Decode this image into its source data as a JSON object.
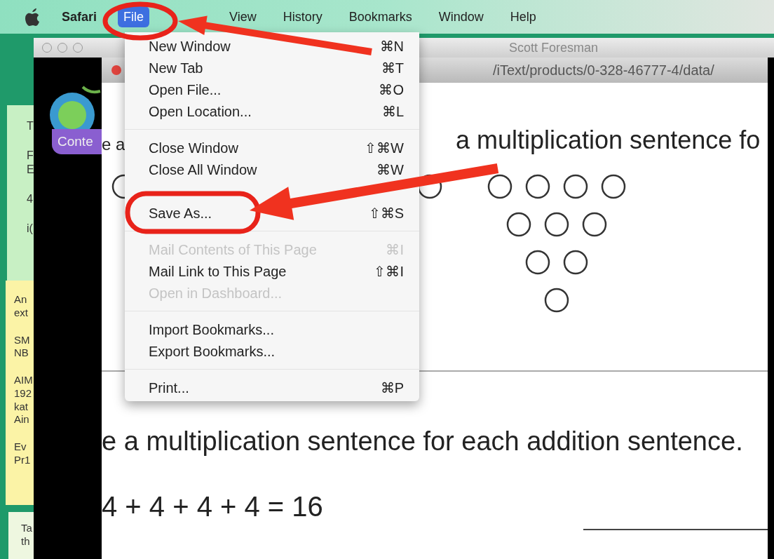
{
  "menubar": {
    "items": [
      {
        "label": "Safari",
        "selected": false,
        "bold": true
      },
      {
        "label": "File",
        "selected": true
      },
      {
        "label": "View",
        "selected": false
      },
      {
        "label": "History",
        "selected": false
      },
      {
        "label": "Bookmarks",
        "selected": false
      },
      {
        "label": "Window",
        "selected": false
      },
      {
        "label": "Help",
        "selected": false
      }
    ]
  },
  "desktop": {
    "green_panel": [
      "T",
      "F\nE",
      "4",
      "i("
    ],
    "sticky_note": [
      "An\next",
      "SM\nNB",
      "AIM\n192\nkat\nAin",
      "Ev\nPr1"
    ],
    "bottom_panel": [
      "Ta\nth"
    ]
  },
  "back_window": {
    "title": "Scott Foresman",
    "tab": {
      "label": "Conte",
      "selected": true
    }
  },
  "browser": {
    "url": "/iText/products/0-328-46777-4/data/",
    "page": {
      "line_start": "e a",
      "line_end": "a multiplication sentence fo",
      "instruction": "e a multiplication sentence for each addition sentence.",
      "equation": "4 + 4 + 4 + 4 = 16"
    }
  },
  "file_menu": {
    "items": [
      {
        "kind": "item",
        "label": "New Window",
        "shortcut": "⌘N",
        "disabled": false
      },
      {
        "kind": "item",
        "label": "New Tab",
        "shortcut": "⌘T",
        "disabled": false
      },
      {
        "kind": "item",
        "label": "Open File...",
        "shortcut": "⌘O",
        "disabled": false
      },
      {
        "kind": "item",
        "label": "Open Location...",
        "shortcut": "⌘L",
        "disabled": false
      },
      {
        "kind": "separator"
      },
      {
        "kind": "item",
        "label": "Close Window",
        "shortcut": "⇧⌘W",
        "disabled": false
      },
      {
        "kind": "item",
        "label": "Close All Window",
        "shortcut": "⌘W",
        "disabled": false
      },
      {
        "kind": "gap"
      },
      {
        "kind": "item",
        "label": "Save As...",
        "shortcut": "⇧⌘S",
        "disabled": false
      },
      {
        "kind": "separator"
      },
      {
        "kind": "item",
        "label": "Mail Contents of This Page",
        "shortcut": "⌘I",
        "disabled": true
      },
      {
        "kind": "item",
        "label": "Mail Link to This Page",
        "shortcut": "⇧⌘I",
        "disabled": false
      },
      {
        "kind": "item",
        "label": "Open in Dashboard...",
        "disabled": true
      },
      {
        "kind": "separator"
      },
      {
        "kind": "item",
        "label": "Import Bookmarks...",
        "disabled": false
      },
      {
        "kind": "item",
        "label": "Export Bookmarks...",
        "disabled": false
      },
      {
        "kind": "separator"
      },
      {
        "kind": "item",
        "label": "Print...",
        "shortcut": "⌘P",
        "disabled": false
      }
    ]
  }
}
